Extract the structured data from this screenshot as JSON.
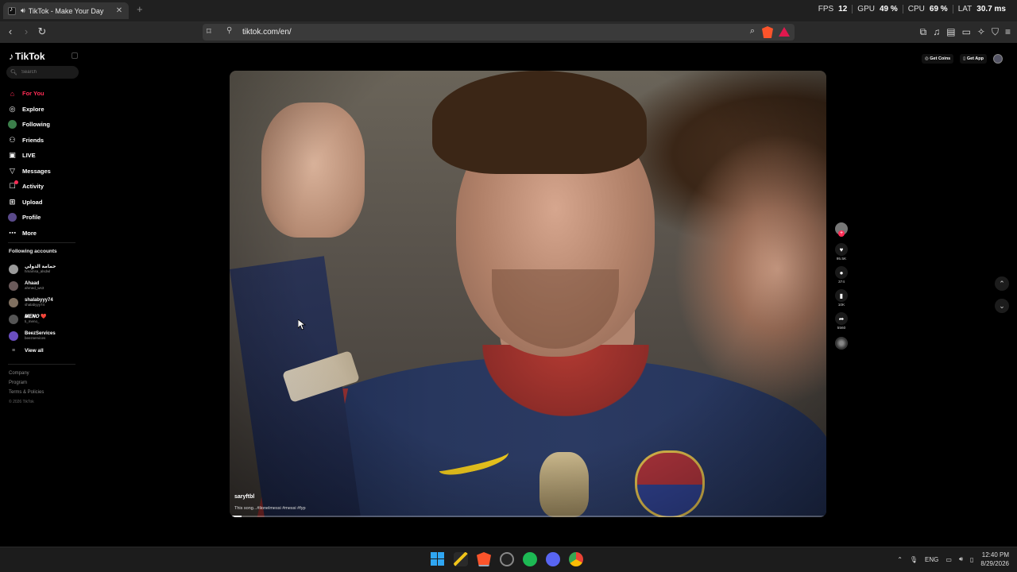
{
  "browser": {
    "tab_title": "TikTok - Make Your Day",
    "tab_close": "✕",
    "new_tab": "+",
    "url": "tiktok.com/en/",
    "stats": {
      "fps_label": "FPS",
      "fps_value": "12",
      "gpu_label": "GPU",
      "gpu_value": "49 %",
      "cpu_label": "CPU",
      "cpu_value": "69 %",
      "lat_label": "LAT",
      "lat_value": "30.7 ms"
    }
  },
  "tiktok": {
    "logo": "TikTok",
    "search_placeholder": "Search",
    "nav": [
      {
        "label": "For You",
        "icon": "home-icon"
      },
      {
        "label": "Explore",
        "icon": "compass-icon"
      },
      {
        "label": "Following",
        "icon": "following-icon"
      },
      {
        "label": "Friends",
        "icon": "friends-icon"
      },
      {
        "label": "LIVE",
        "icon": "live-icon"
      },
      {
        "label": "Messages",
        "icon": "messages-icon"
      },
      {
        "label": "Activity",
        "icon": "activity-icon"
      },
      {
        "label": "Upload",
        "icon": "upload-icon"
      },
      {
        "label": "Profile",
        "icon": "profile-icon"
      },
      {
        "label": "More",
        "icon": "more-icon"
      }
    ],
    "following_title": "Following accounts",
    "accounts": [
      {
        "name": "حمامة الدولي",
        "handle": "hmamsa_alsdwl"
      },
      {
        "name": "Ahaad",
        "handle": "ahmed_ws3"
      },
      {
        "name": "shalabyyy74",
        "handle": "shalabyyy74"
      },
      {
        "name": "𝑴𝑬𝑵𝑶 ❤️",
        "handle": "ti_meno_"
      },
      {
        "name": "BeezServices",
        "handle": "beezservices"
      }
    ],
    "view_all": "View all",
    "footer": {
      "company": "Company",
      "program": "Program",
      "terms": "Terms & Policies",
      "copyright": "© 2026 TikTok"
    },
    "top_actions": {
      "get_coins": "Get Coins",
      "get_app": "Get App"
    },
    "video": {
      "author": "saryftbl",
      "caption": "This song...#lionelmessi #messi #fyp",
      "progress": 0.02
    },
    "actions": {
      "likes": "95.5K",
      "comments": "374",
      "saves": "10K",
      "shares": "5560"
    }
  },
  "taskbar": {
    "lang": "ENG",
    "time": "12:40 PM",
    "date": "8/29/2026"
  },
  "colors": {
    "accent": "#fe2c55",
    "chrome_bg": "#202020",
    "page_bg": "#000000"
  }
}
